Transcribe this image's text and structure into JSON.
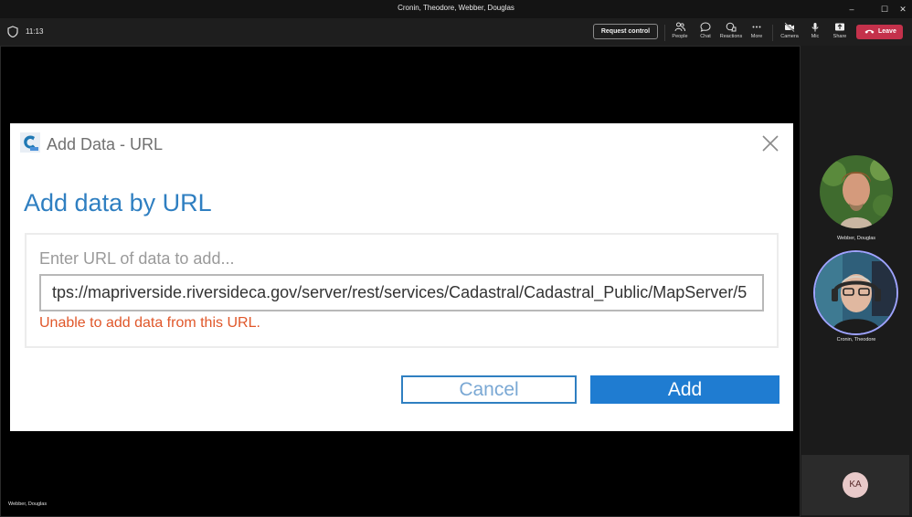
{
  "window": {
    "title": "Cronin, Theodore, Webber, Douglas",
    "minimize": "–",
    "maximize": "☐",
    "close": "✕"
  },
  "toolbar": {
    "timer": "11:13",
    "request_control": "Request control",
    "people": "People",
    "chat": "Chat",
    "reactions": "Reactions",
    "more": "More",
    "camera": "Camera",
    "mic": "Mic",
    "share": "Share",
    "leave": "Leave",
    "leave_color": "#c4314b"
  },
  "stage": {
    "presenter_name": "Webber, Douglas"
  },
  "participants": [
    {
      "name": "Webber, Douglas",
      "avatar": "photo"
    },
    {
      "name": "Cronin, Theodore",
      "avatar": "photo",
      "speaking": true
    },
    {
      "initials": "KA"
    }
  ],
  "dialog": {
    "window_title": "Add Data - URL",
    "heading": "Add data by URL",
    "hint": "Enter URL of data to add...",
    "url_value": "tps://mapriverside.riversideca.gov/server/rest/services/Cadastral/Cadastral_Public/MapServer/5",
    "error": "Unable to add data from this URL.",
    "cancel": "Cancel",
    "add": "Add",
    "accent_color": "#2f7fc1",
    "error_color": "#e0572a"
  }
}
